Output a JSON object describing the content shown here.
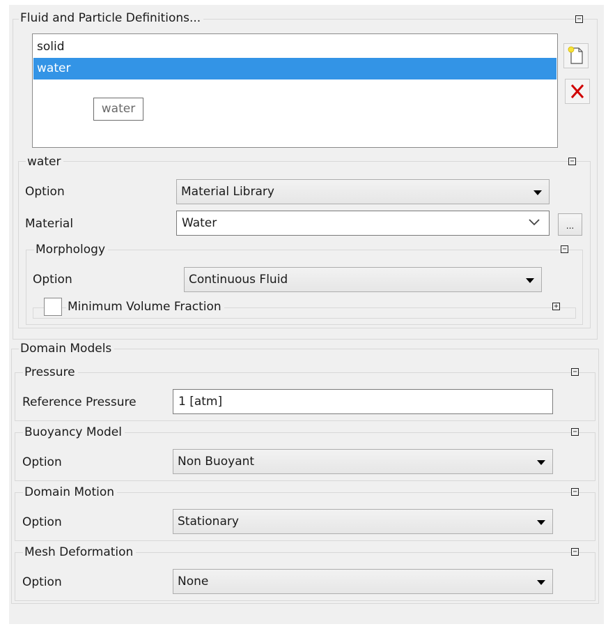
{
  "fluid_section": {
    "title": "Fluid and Particle Definitions...",
    "list": [
      "solid",
      "water"
    ],
    "selected_index": 1,
    "tooltip": "water"
  },
  "water_section": {
    "title": "water",
    "option_label": "Option",
    "option_value": "Material Library",
    "material_label": "Material",
    "material_value": "Water",
    "browse_label": "...",
    "morphology": {
      "title": "Morphology",
      "option_label": "Option",
      "option_value": "Continuous Fluid",
      "min_volume_fraction_label": "Minimum Volume Fraction",
      "min_volume_fraction_checked": false
    }
  },
  "domain_models": {
    "title": "Domain Models",
    "pressure": {
      "title": "Pressure",
      "label": "Reference Pressure",
      "value": "1 [atm]"
    },
    "buoyancy": {
      "title": "Buoyancy Model",
      "label": "Option",
      "value": "Non Buoyant"
    },
    "motion": {
      "title": "Domain Motion",
      "label": "Option",
      "value": "Stationary"
    },
    "mesh": {
      "title": "Mesh Deformation",
      "label": "Option",
      "value": "None"
    }
  },
  "toggles": {
    "collapse": "⊟",
    "expand": "⊞"
  },
  "icons": {
    "new": "new-document-icon",
    "delete": "delete-x-icon",
    "arrow": "dropdown-arrow-icon"
  },
  "colors": {
    "selection": "#3394e6",
    "delete_red": "#d00000",
    "panel_bg": "#f0f0f0"
  }
}
